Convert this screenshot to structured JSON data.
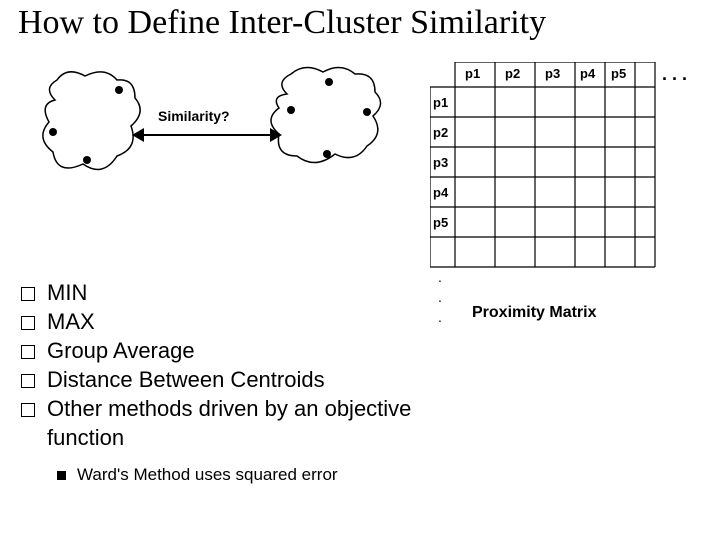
{
  "title": "How to Define Inter-Cluster Similarity",
  "diagram": {
    "similarity_label": "Similarity?"
  },
  "matrix": {
    "col_labels": [
      "p1",
      "p2",
      "p3",
      "p4",
      "p5"
    ],
    "row_labels": [
      "p1",
      "p2",
      "p3",
      "p4",
      "p5"
    ],
    "h_ellipsis": ". . .",
    "v_dot": ".",
    "caption": "Proximity Matrix"
  },
  "bullets": {
    "items": [
      "MIN",
      "MAX",
      "Group Average",
      "Distance Between Centroids",
      "Other methods driven by an objective function"
    ],
    "sub": "Ward's Method uses squared error"
  }
}
